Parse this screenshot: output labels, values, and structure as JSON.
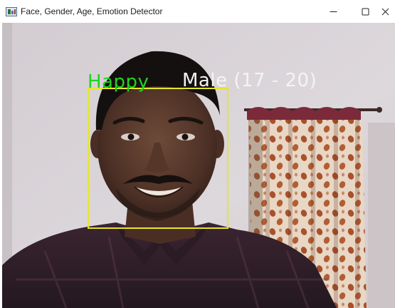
{
  "window": {
    "title": "Face, Gender, Age, Emotion Detector",
    "controls": {
      "minimize_icon": "minimize-icon",
      "maximize_icon": "maximize-icon",
      "close_icon": "close-icon"
    }
  },
  "detection": {
    "emotion": "Happy",
    "gender_age": "Male (17 - 20)",
    "emotion_color": "#1fd31f",
    "info_color": "#f4f4f4",
    "box_color": "#e6e62a"
  }
}
